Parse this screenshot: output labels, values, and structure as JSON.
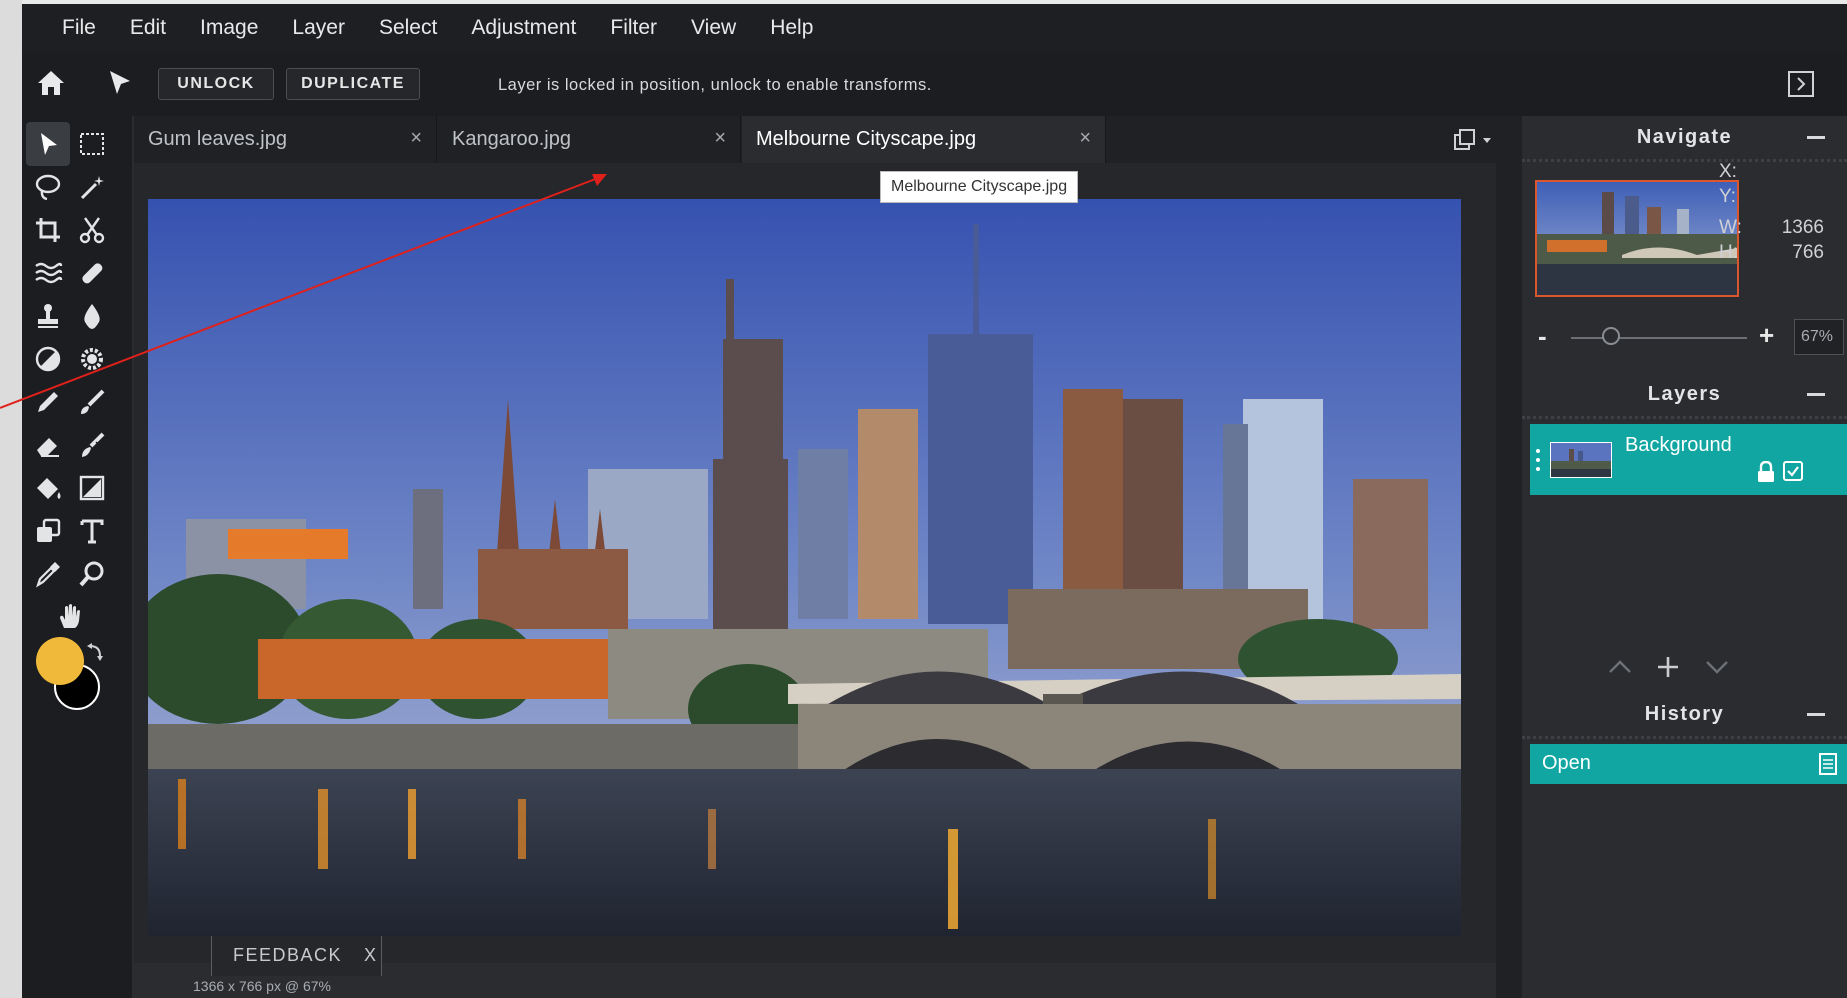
{
  "menubar": {
    "items": [
      "File",
      "Edit",
      "Image",
      "Layer",
      "Select",
      "Adjustment",
      "Filter",
      "View",
      "Help"
    ]
  },
  "toolbar": {
    "unlock_label": "UNLOCK",
    "duplicate_label": "DUPLICATE",
    "message": "Layer is locked in position, unlock to enable transforms."
  },
  "tabs": [
    {
      "label": "Gum leaves.jpg"
    },
    {
      "label": "Kangaroo.jpg"
    },
    {
      "label": "Melbourne Cityscape.jpg"
    }
  ],
  "tab_close_glyph": "×",
  "tooltip": "Melbourne Cityscape.jpg",
  "navigate": {
    "title": "Navigate",
    "x_label": "X:",
    "y_label": "Y:",
    "w_label": "W:",
    "w_value": "1366",
    "h_label": "H:",
    "h_value": "766",
    "zoom_minus": "-",
    "zoom_plus": "+",
    "zoom_value": "67%"
  },
  "layers": {
    "title": "Layers",
    "items": [
      {
        "name": "Background"
      }
    ]
  },
  "history": {
    "title": "History",
    "items": [
      {
        "name": "Open"
      }
    ]
  },
  "feedback": {
    "label": "FEEDBACK",
    "close": "X"
  },
  "status": "1366 x 766 px @ 67%",
  "colors": {
    "accent": "#11a6a2",
    "foreground_color": "#f0b93a",
    "background_color": "#000000",
    "annotation_arrow": "#e0201a"
  }
}
